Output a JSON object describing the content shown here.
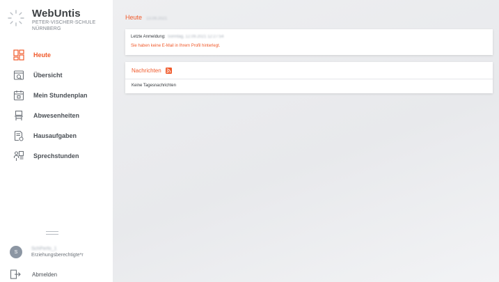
{
  "brand": {
    "name": "WebUntis",
    "school_line1": "PETER-VISCHER-SCHULE",
    "school_line2": "NÜRNBERG"
  },
  "nav": {
    "items": [
      {
        "label": "Heute",
        "icon": "dashboard-grid-icon",
        "active": true
      },
      {
        "label": "Übersicht",
        "icon": "overview-icon",
        "active": false
      },
      {
        "label": "Mein Stundenplan",
        "icon": "calendar-icon",
        "active": false
      },
      {
        "label": "Abwesenheiten",
        "icon": "absence-chair-icon",
        "active": false
      },
      {
        "label": "Hausaufgaben",
        "icon": "homework-document-icon",
        "active": false
      },
      {
        "label": "Sprechstunden",
        "icon": "consultation-icon",
        "active": false
      }
    ]
  },
  "user": {
    "avatar_initial": "S",
    "name": "SchPerfo_1",
    "role": "Erziehungsberechtigte*r"
  },
  "logout": {
    "label": "Abmelden"
  },
  "main": {
    "title": "Heute",
    "date": "13.09.2021",
    "login_card": {
      "last_login_label": "Letzte Anmeldung:",
      "last_login_value": "Sonntag, 12.09.2021 12:27:54",
      "email_warning": "Sie haben keine E-Mail in Ihrem Profil hinterlegt."
    },
    "news_card": {
      "title": "Nachrichten",
      "empty_text": "Keine Tagesnachrichten"
    }
  },
  "colors": {
    "accent": "#f0592a",
    "text_dark": "#4a4f55",
    "background": "#eceef0"
  }
}
